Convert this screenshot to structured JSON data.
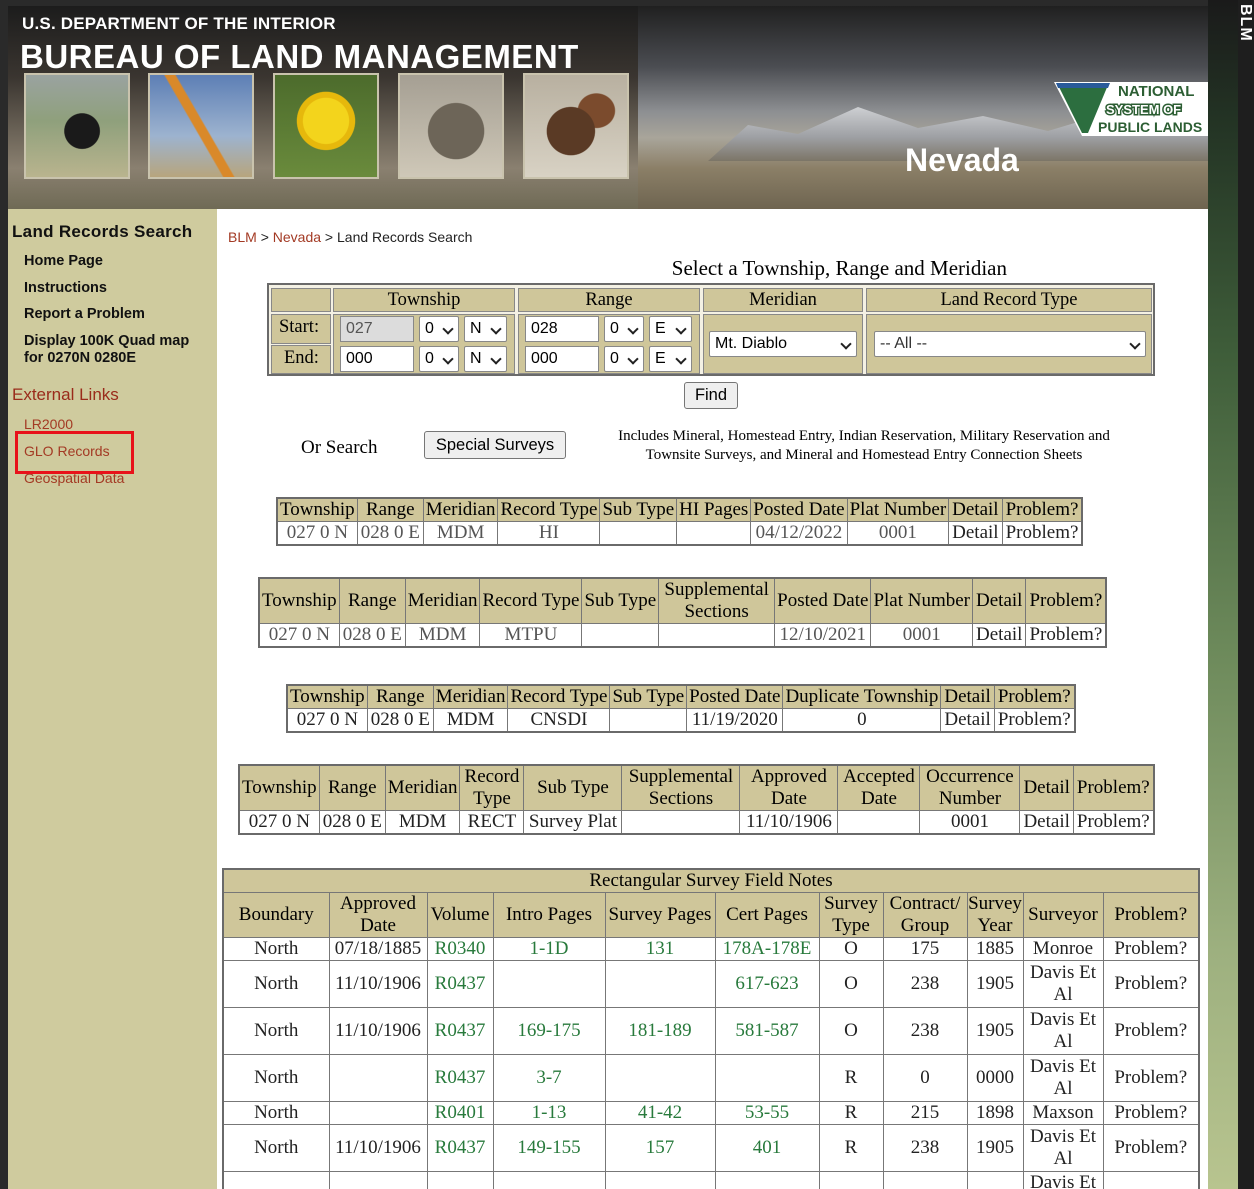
{
  "header": {
    "department": "U.S. DEPARTMENT OF THE INTERIOR",
    "bureau": "BUREAU OF LAND MANAGEMENT",
    "state": "Nevada",
    "npl_logo": [
      "NATIONAL",
      "SYSTEM OF",
      "PUBLIC LANDS"
    ],
    "edge_text": "BLM"
  },
  "sidebar": {
    "title": "Land Records Search",
    "items": [
      "Home Page",
      "Instructions",
      "Report a Problem",
      "Display 100K Quad map",
      "for 0270N 0280E"
    ],
    "external_title": "External Links",
    "links": [
      "LR2000",
      "GLO Records",
      "Geospatial Data"
    ]
  },
  "breadcrumb": {
    "blm": "BLM",
    "sep": ">",
    "nevada": "Nevada",
    "current": "Land Records Search"
  },
  "search_form": {
    "title": "Select a Township, Range and Meridian",
    "headers": {
      "township": "Township",
      "range": "Range",
      "meridian": "Meridian",
      "record_type": "Land Record Type"
    },
    "start_label": "Start:",
    "end_label": "End:",
    "start": {
      "township": "027",
      "t_frac": "0",
      "t_dir": "N",
      "range": "028",
      "r_frac": "0",
      "r_dir": "E"
    },
    "end": {
      "township": "000",
      "t_frac": "0",
      "t_dir": "N",
      "range": "000",
      "r_frac": "0",
      "r_dir": "E"
    },
    "meridian": "Mt. Diablo",
    "record_type": "-- All --",
    "find": "Find",
    "or_search": "Or Search",
    "special_surveys": "Special Surveys",
    "special_desc": "Includes Mineral, Homestead Entry, Indian Reservation, Military Reservation and Townsite Surveys, and Mineral and Homestead Entry Connection Sheets"
  },
  "table1": {
    "headers": [
      "Township",
      "Range",
      "Meridian",
      "Record Type",
      "Sub Type",
      "HI Pages",
      "Posted Date",
      "Plat Number",
      "Detail",
      "Problem?"
    ],
    "rows": [
      [
        "027 0 N",
        "028 0 E",
        "MDM",
        "HI",
        "",
        "",
        "04/12/2022",
        "0001",
        "Detail",
        "Problem?"
      ]
    ]
  },
  "table2": {
    "headers": [
      "Township",
      "Range",
      "Meridian",
      "Record Type",
      "Sub Type",
      "Supplemental Sections",
      "Posted Date",
      "Plat Number",
      "Detail",
      "Problem?"
    ],
    "rows": [
      [
        "027 0 N",
        "028 0 E",
        "MDM",
        "MTPU",
        "",
        "",
        "12/10/2021",
        "0001",
        "Detail",
        "Problem?"
      ]
    ]
  },
  "table3": {
    "headers": [
      "Township",
      "Range",
      "Meridian",
      "Record Type",
      "Sub Type",
      "Posted Date",
      "Duplicate Township",
      "Detail",
      "Problem?"
    ],
    "rows": [
      [
        "027 0 N",
        "028 0 E",
        "MDM",
        "CNSDI",
        "",
        "11/19/2020",
        "0",
        "Detail",
        "Problem?"
      ]
    ]
  },
  "table4": {
    "headers": [
      "Township",
      "Range",
      "Meridian",
      "Record Type",
      "Sub Type",
      "Supplemental Sections",
      "Approved Date",
      "Accepted Date",
      "Occurrence Number",
      "Detail",
      "Problem?"
    ],
    "rows": [
      [
        "027 0 N",
        "028 0 E",
        "MDM",
        "RECT",
        "Survey Plat",
        "",
        "11/10/1906",
        "",
        "0001",
        "Detail",
        "Problem?"
      ]
    ]
  },
  "field_notes": {
    "title": "Rectangular Survey Field Notes",
    "headers": [
      "Boundary",
      "Approved Date",
      "Volume",
      "Intro Pages",
      "Survey Pages",
      "Cert Pages",
      "Survey Type",
      "Contract/ Group",
      "Survey Year",
      "Surveyor",
      "Problem?"
    ],
    "rows": [
      [
        "North",
        "07/18/1885",
        "R0340",
        "1-1D",
        "131",
        "178A-178E",
        "O",
        "175",
        "1885",
        "Monroe",
        "Problem?"
      ],
      [
        "North",
        "11/10/1906",
        "R0437",
        "",
        "",
        "617-623",
        "O",
        "238",
        "1905",
        "Davis Et Al",
        "Problem?"
      ],
      [
        "North",
        "11/10/1906",
        "R0437",
        "169-175",
        "181-189",
        "581-587",
        "O",
        "238",
        "1905",
        "Davis Et Al",
        "Problem?"
      ],
      [
        "North",
        "",
        "R0437",
        "3-7",
        "",
        "",
        "R",
        "0",
        "0000",
        "Davis Et Al",
        "Problem?"
      ],
      [
        "North",
        "",
        "R0401",
        "1-13",
        "41-42",
        "53-55",
        "R",
        "215",
        "1898",
        "Maxson",
        "Problem?"
      ],
      [
        "North",
        "11/10/1906",
        "R0437",
        "149-155",
        "157",
        "401",
        "R",
        "238",
        "1905",
        "Davis Et Al",
        "Problem?"
      ],
      [
        "",
        "",
        "",
        "",
        "",
        "",
        "",
        "",
        "",
        "Davis Et",
        ""
      ]
    ]
  },
  "colors": {
    "header_tan": "#cfc69a",
    "sidebar": "#cfcb9e",
    "link": "#a33a24",
    "green_text": "#287a3c",
    "highlight": "#e8121a"
  }
}
